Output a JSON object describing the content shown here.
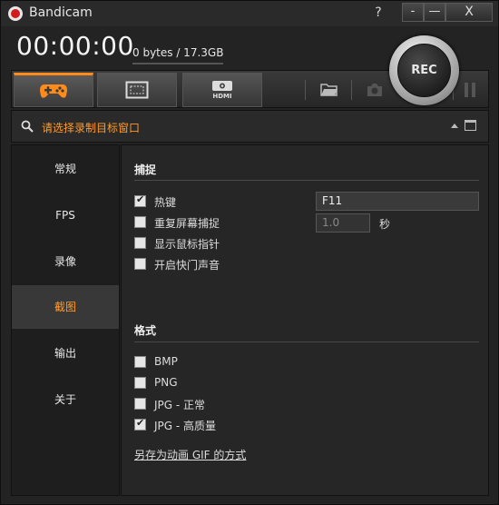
{
  "app": {
    "title": "Bandicam"
  },
  "titlebar": {
    "help": "?",
    "menu": "-",
    "minimize": "—",
    "close": "X"
  },
  "status": {
    "timer": "00:00:00",
    "size": "0 bytes / 17.3GB"
  },
  "rec_button": {
    "label": "REC"
  },
  "toolbar": {
    "tabs": [
      {
        "name": "game-mode",
        "icon": "gamepad-icon",
        "active": true
      },
      {
        "name": "screen-mode",
        "icon": "screen-rect-icon",
        "active": false
      },
      {
        "name": "hdmi-mode",
        "icon": "hdmi-icon",
        "label": "HDMI",
        "active": false
      }
    ],
    "actions": [
      "folder-icon",
      "camera-icon",
      "pause-icon"
    ]
  },
  "search": {
    "text": "请选择录制目标窗口"
  },
  "sidebar": {
    "items": [
      {
        "label": "常规",
        "active": false
      },
      {
        "label": "FPS",
        "active": false
      },
      {
        "label": "录像",
        "active": false
      },
      {
        "label": "截图",
        "active": true
      },
      {
        "label": "输出",
        "active": false
      },
      {
        "label": "关于",
        "active": false
      }
    ]
  },
  "capture": {
    "title": "捕捉",
    "hotkey_label": "热键",
    "hotkey_checked": true,
    "hotkey_value": "F11",
    "repeat_label": "重复屏幕捕捉",
    "repeat_checked": false,
    "repeat_value": "1.0",
    "repeat_unit": "秒",
    "cursor_label": "显示鼠标指针",
    "cursor_checked": false,
    "shutter_label": "开启快门声音",
    "shutter_checked": false
  },
  "format": {
    "title": "格式",
    "options": [
      {
        "label": "BMP",
        "checked": false
      },
      {
        "label": "PNG",
        "checked": false
      },
      {
        "label": "JPG - 正常",
        "checked": false
      },
      {
        "label": "JPG - 高质量",
        "checked": true
      }
    ],
    "gif_link": "另存为动画 GIF 的方式"
  },
  "colors": {
    "accent": "#ff9a2a",
    "rec_red": "#d01c1c",
    "background": "#232323"
  }
}
